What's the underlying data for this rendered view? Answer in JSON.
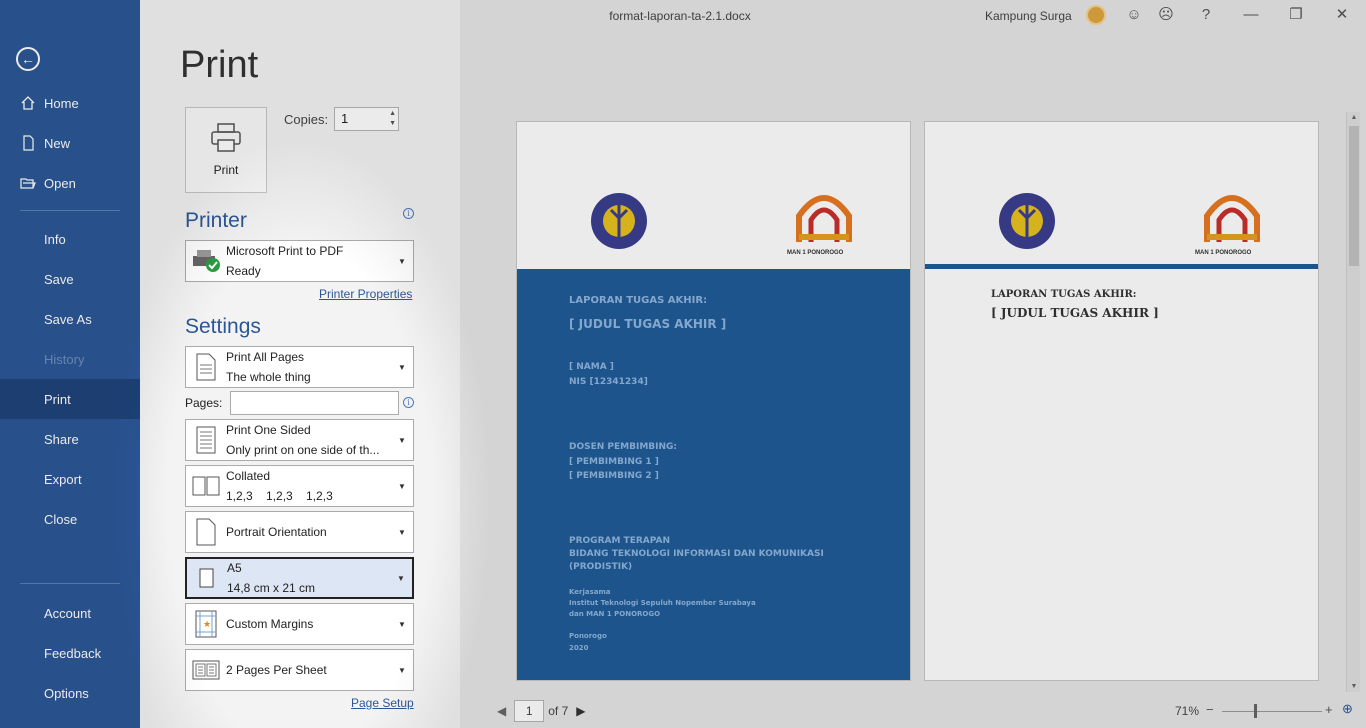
{
  "window": {
    "doc_title": "format-laporan-ta-2.1.docx",
    "user_name": "Kampung Surga",
    "help": "?",
    "minimize": "—",
    "restore": "❐",
    "close": "✕"
  },
  "sidebar": {
    "back": "←",
    "items": [
      {
        "label": "Home"
      },
      {
        "label": "New"
      },
      {
        "label": "Open"
      },
      {
        "label": "Info"
      },
      {
        "label": "Save"
      },
      {
        "label": "Save As"
      },
      {
        "label": "History"
      },
      {
        "label": "Print"
      },
      {
        "label": "Share"
      },
      {
        "label": "Export"
      },
      {
        "label": "Close"
      },
      {
        "label": "Account"
      },
      {
        "label": "Feedback"
      },
      {
        "label": "Options"
      }
    ]
  },
  "print": {
    "page_title": "Print",
    "button_label": "Print",
    "copies_label": "Copies:",
    "copies_value": "1",
    "printer_title": "Printer",
    "printer_name": "Microsoft Print to PDF",
    "printer_status": "Ready",
    "printer_properties": "Printer Properties",
    "settings_title": "Settings",
    "pages_label": "Pages:",
    "settings": [
      {
        "main": "Print All Pages",
        "sub": "The whole thing"
      },
      {
        "main": "Print One Sided",
        "sub": "Only print on one side of th..."
      },
      {
        "main": "Collated",
        "sub": "1,2,3    1,2,3    1,2,3"
      },
      {
        "main": "Portrait Orientation",
        "sub": ""
      },
      {
        "main": "A5",
        "sub": "14,8 cm x 21 cm"
      },
      {
        "main": "Custom Margins",
        "sub": ""
      },
      {
        "main": "2 Pages Per Sheet",
        "sub": ""
      }
    ],
    "page_setup": "Page Setup"
  },
  "preview": {
    "page1": {
      "line1": "LAPORAN TUGAS AKHIR:",
      "line2": "[ JUDUL TUGAS AKHIR ]",
      "name": "[ NAMA ]",
      "nis": "NIS [12341234]",
      "dosen": "DOSEN PEMBIMBING:",
      "pemb1": "[ PEMBIMBING 1 ]",
      "pemb2": "[ PEMBIMBING 2 ]",
      "program1": "PROGRAM TERAPAN",
      "program2": "BIDANG TEKNOLOGI INFORMASI DAN KOMUNIKASI",
      "program3": "(PRODISTIK)",
      "kerja1": "Kerjasama",
      "kerja2": "Institut Teknologi Sepuluh Nopember Surabaya",
      "kerja3": "dan MAN 1 PONOROGO",
      "city": "Ponorogo",
      "year": "2020",
      "logo_caption": "MAN 1 PONOROGO"
    },
    "page2": {
      "line1": "LAPORAN TUGAS AKHIR:",
      "line2": "[ JUDUL TUGAS AKHIR ]",
      "logo_caption": "MAN 1 PONOROGO"
    },
    "current_page": "1",
    "of_pages": "of 7",
    "zoom": "71%",
    "zoom_minus": "−",
    "zoom_plus": "+"
  },
  "colors": {
    "sidebar_bg": "#2b5797",
    "sidebar_active": "#1e437a",
    "accent": "#2b5797",
    "cover_blue": "#1f5b98"
  }
}
